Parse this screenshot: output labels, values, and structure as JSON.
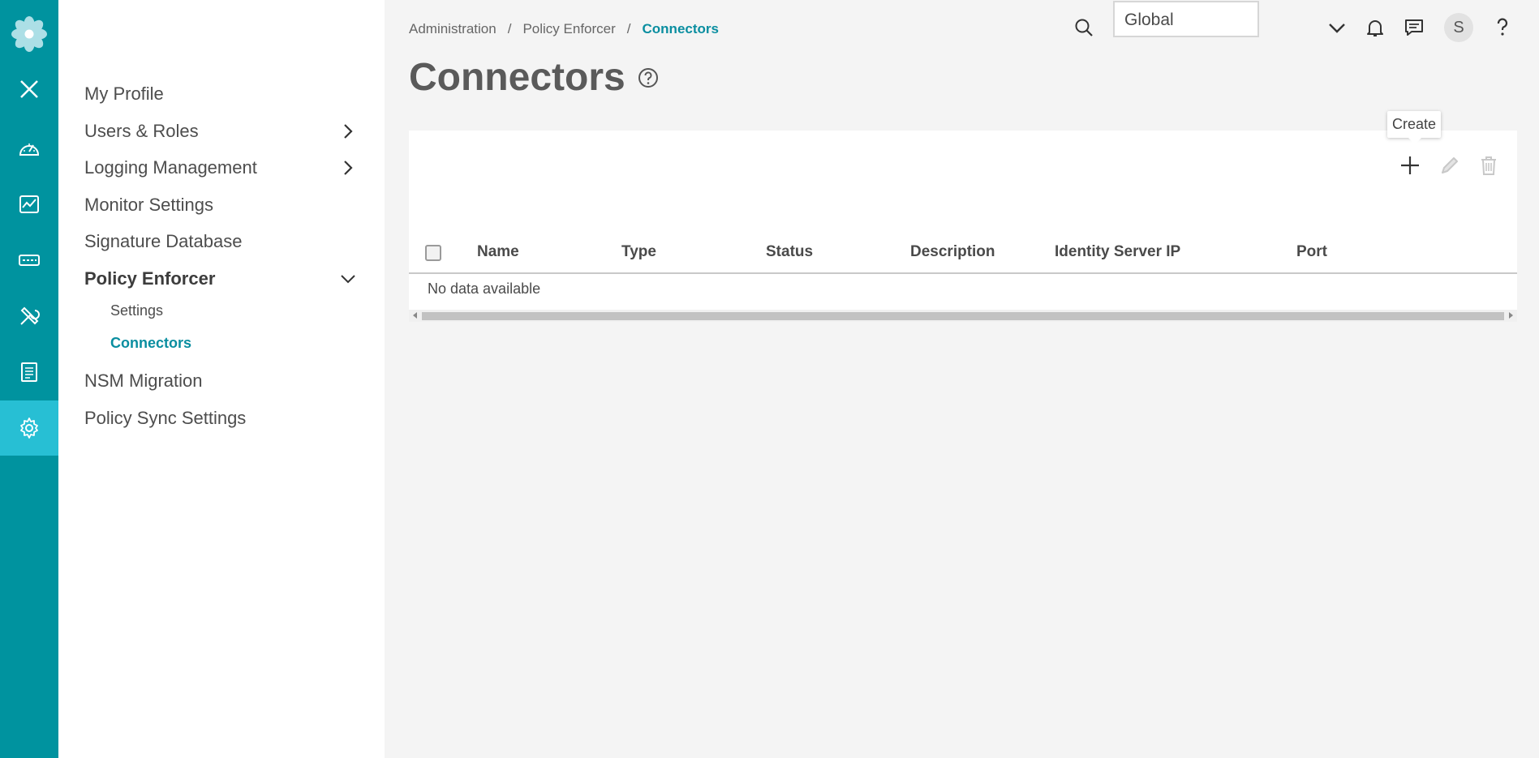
{
  "breadcrumb": [
    "Administration",
    "Policy Enforcer",
    "Connectors"
  ],
  "page": {
    "title": "Connectors"
  },
  "header": {
    "domain_value": "Global",
    "avatar_initial": "S"
  },
  "rail": {
    "items": [
      "logo-icon",
      "close-icon",
      "dashboard-icon",
      "monitor-icon",
      "devices-icon",
      "configure-icon",
      "reports-icon",
      "administration-icon"
    ],
    "active": "administration-icon",
    "color": "#00939f",
    "active_color": "#27bfd4"
  },
  "nav": {
    "items": [
      {
        "label": "My Profile"
      },
      {
        "label": "Users & Roles"
      },
      {
        "label": "Logging Management"
      },
      {
        "label": "Monitor Settings"
      },
      {
        "label": "Signature Database"
      },
      {
        "label": "Policy Enforcer"
      },
      {
        "label": "NSM Migration"
      },
      {
        "label": "Policy Sync Settings"
      }
    ],
    "sub_items": [
      {
        "label": "Settings"
      },
      {
        "label": "Connectors"
      }
    ]
  },
  "toolbar": {
    "tooltip": "Create"
  },
  "table": {
    "columns": [
      "Name",
      "Type",
      "Status",
      "Description",
      "Identity Server IP",
      "Port"
    ],
    "empty_text": "No data available"
  },
  "colors": {
    "accent": "#0a8ea0"
  }
}
